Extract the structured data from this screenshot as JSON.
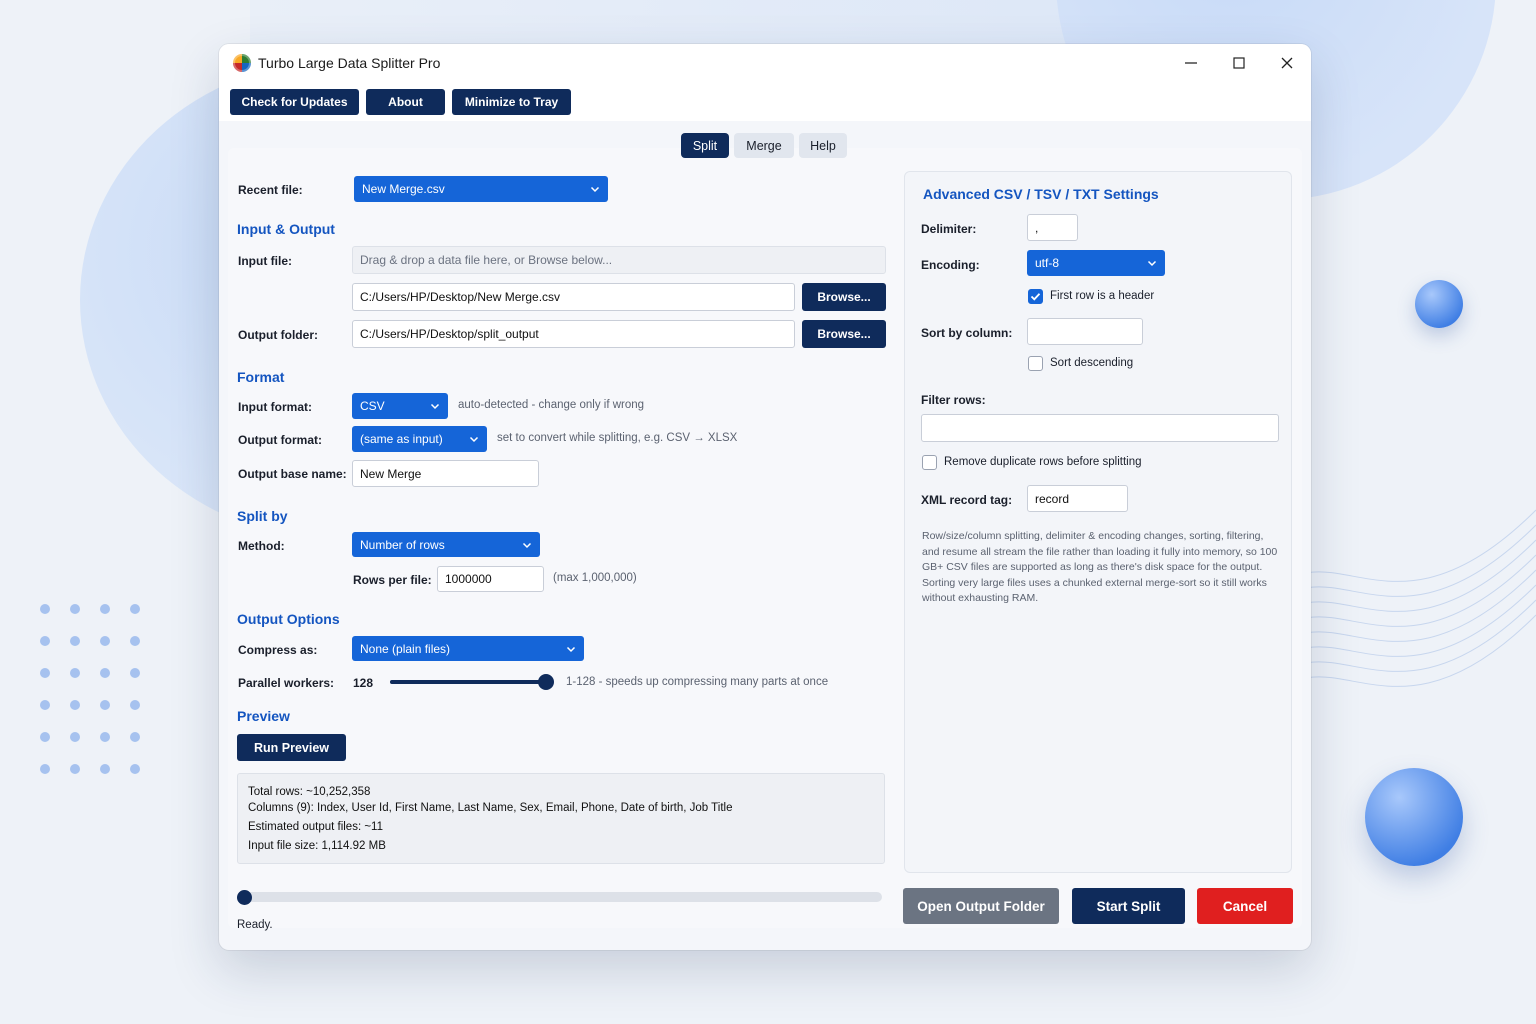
{
  "window": {
    "title": "Turbo Large Data Splitter Pro"
  },
  "toolbar": {
    "check_updates": "Check for Updates",
    "about": "About",
    "minimize_tray": "Minimize to Tray"
  },
  "tabs": [
    {
      "label": "Split",
      "active": true
    },
    {
      "label": "Merge",
      "active": false
    },
    {
      "label": "Help",
      "active": false
    }
  ],
  "left": {
    "recent_file_label": "Recent file:",
    "recent_file_value": "New Merge.csv",
    "input_output_title": "Input & Output",
    "input_file_label": "Input file:",
    "drop_placeholder": "Drag & drop a data file here, or Browse below...",
    "input_path": "C:/Users/HP/Desktop/New Merge.csv",
    "browse": "Browse...",
    "output_folder_label": "Output folder:",
    "output_path": "C:/Users/HP/Desktop/split_output",
    "format_title": "Format",
    "input_format_label": "Input format:",
    "input_format_value": "CSV",
    "input_format_hint": "auto-detected - change only if wrong",
    "output_format_label": "Output format:",
    "output_format_value": "(same as input)",
    "output_format_hint": "set to convert while splitting, e.g. CSV → XLSX",
    "output_base_label": "Output base name:",
    "output_base_value": "New Merge",
    "split_by_title": "Split by",
    "method_label": "Method:",
    "method_value": "Number of rows",
    "rows_per_file_label": "Rows per file:",
    "rows_per_file_value": "1000000",
    "rows_per_file_hint": "(max 1,000,000)",
    "output_options_title": "Output Options",
    "compress_label": "Compress as:",
    "compress_value": "None (plain files)",
    "workers_label": "Parallel workers:",
    "workers_value": "128",
    "workers_level": 1.0,
    "workers_hint": "1-128 - speeds up compressing many parts at once",
    "preview_title": "Preview",
    "run_preview": "Run Preview",
    "preview_lines": [
      "Total rows: ~10,252,358",
      "Columns (9): Index, User Id, First Name, Last Name, Sex, Email, Phone, Date of birth, Job Title",
      "Estimated output files: ~11",
      "Input file size: 1,114.92 MB"
    ],
    "progress": 0,
    "status": "Ready."
  },
  "right": {
    "title": "Advanced CSV / TSV / TXT Settings",
    "delimiter_label": "Delimiter:",
    "delimiter_value": ",",
    "encoding_label": "Encoding:",
    "encoding_value": "utf-8",
    "header_checkbox": "First row is a header",
    "header_checked": true,
    "sort_label": "Sort by column:",
    "sort_value": "",
    "sort_desc": "Sort descending",
    "sort_desc_checked": false,
    "filter_label": "Filter rows:",
    "filter_value": "",
    "dedupe": "Remove duplicate rows before splitting",
    "dedupe_checked": false,
    "xml_label": "XML record tag:",
    "xml_value": "record",
    "note": "Row/size/column splitting, delimiter & encoding changes, sorting, filtering, and resume all stream the file rather than loading it fully into memory, so 100 GB+ CSV files are supported as long as there's disk space for the output. Sorting very large files uses a chunked external merge-sort so it still works without exhausting RAM."
  },
  "actions": {
    "open_output": "Open Output Folder",
    "start_split": "Start Split",
    "cancel": "Cancel"
  },
  "colors": {
    "navy": "#0f2b5b",
    "accent_blue": "#1565d8",
    "section_blue": "#1455c0",
    "cancel_red": "#e01f1f",
    "grey_button": "#6b7482"
  },
  "icons": {
    "app": "app-globe-icon",
    "minimize": "minimize-icon",
    "maximize": "maximize-icon",
    "close": "close-icon",
    "dropdown": "chevron-down-icon",
    "check": "checkmark-icon"
  }
}
